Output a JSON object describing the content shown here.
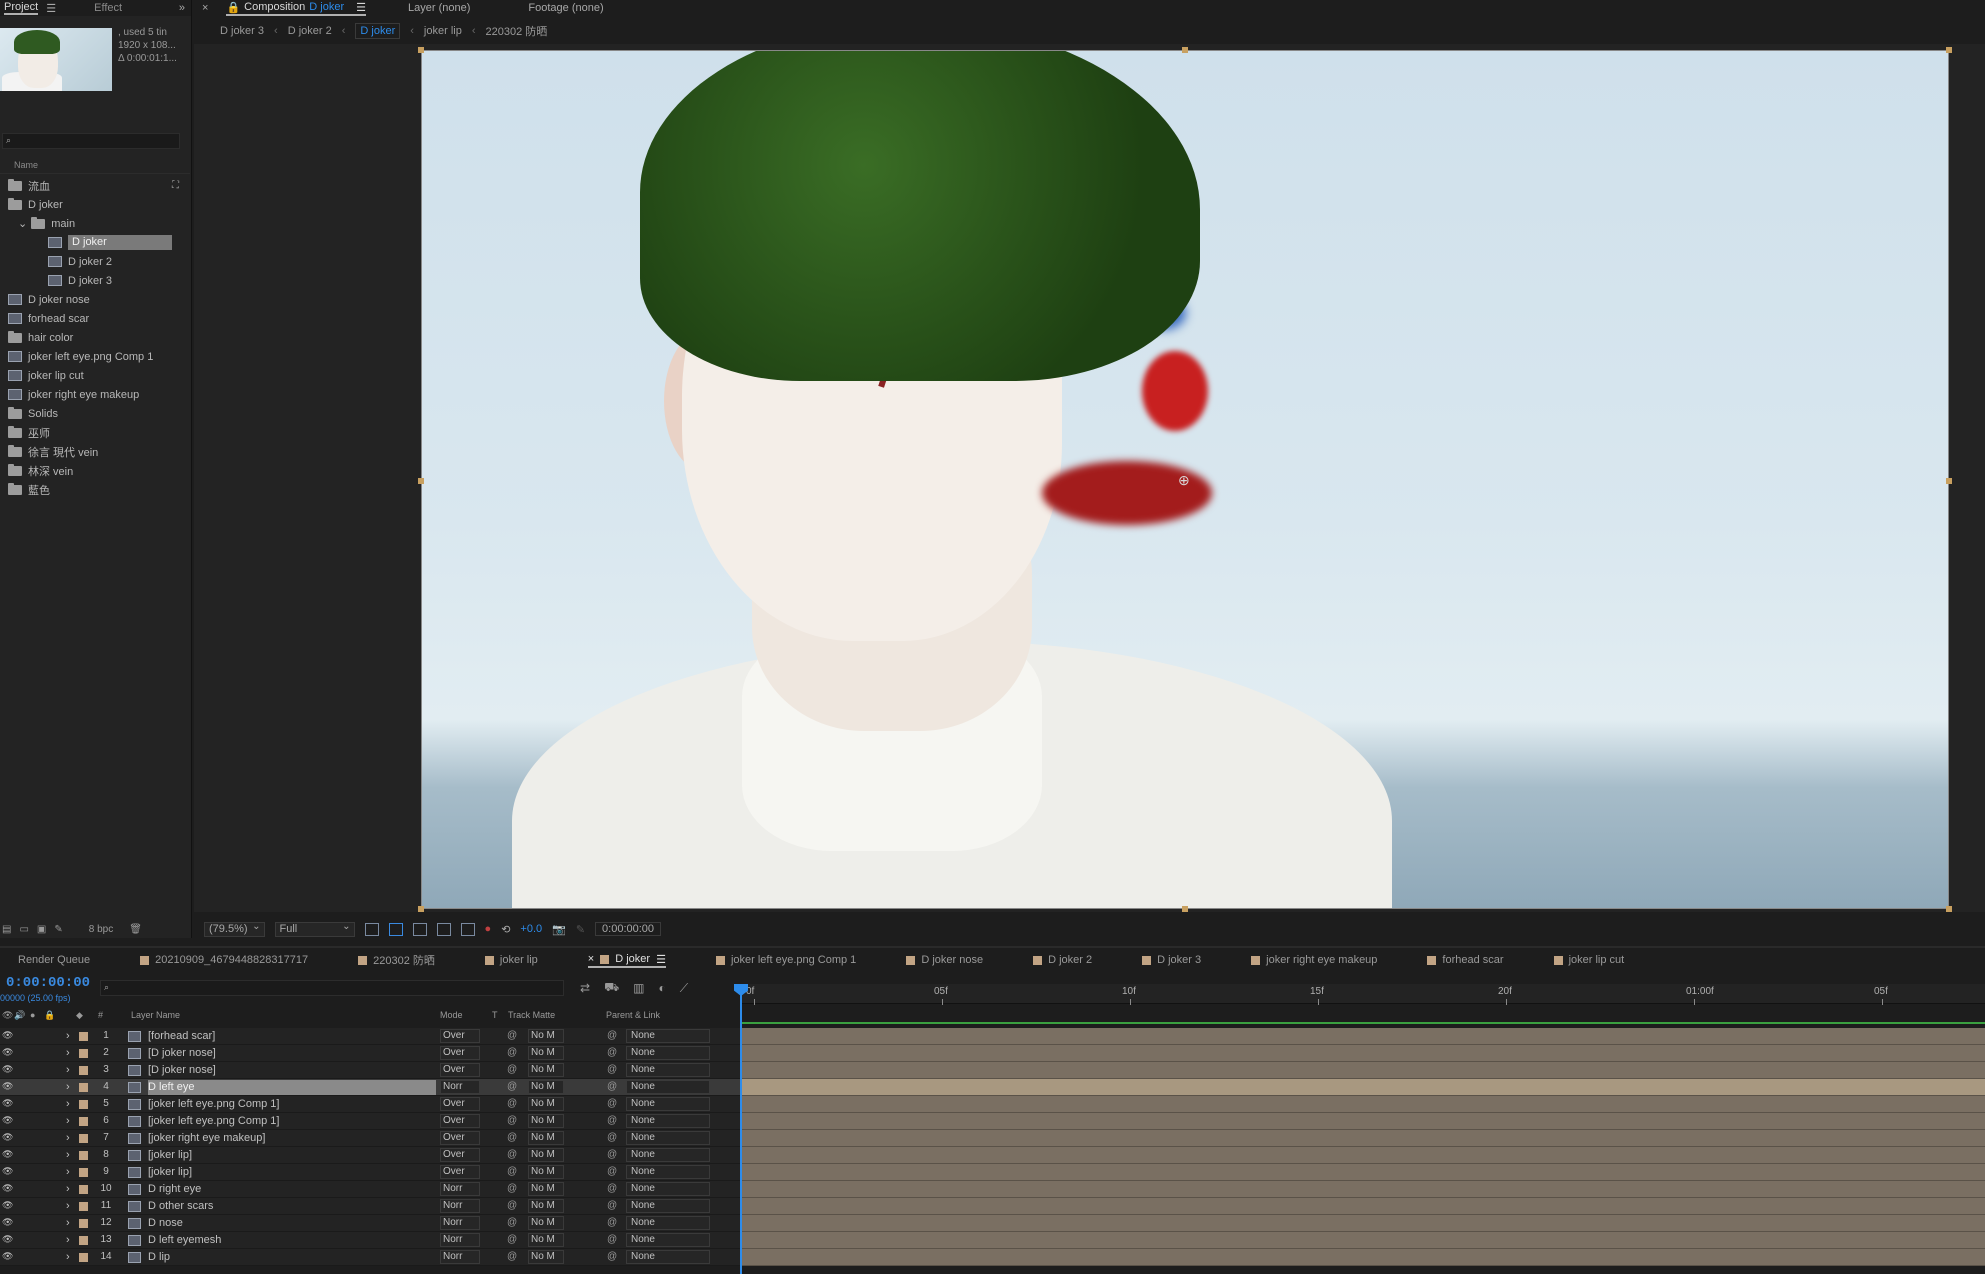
{
  "project": {
    "tabs": [
      "Project",
      "Effect"
    ],
    "info": ", used 5 tin",
    "resolution": "1920 x 108...",
    "duration": "Δ 0:00:01:1...",
    "name_header": "Name",
    "items": [
      {
        "label": "流血",
        "type": "folder",
        "indent": 0
      },
      {
        "label": "D joker",
        "type": "folder",
        "indent": 0
      },
      {
        "label": "main",
        "type": "folder",
        "indent": 1
      },
      {
        "label": "D joker",
        "type": "comp",
        "indent": 2,
        "selected": true
      },
      {
        "label": "D joker 2",
        "type": "comp",
        "indent": 2
      },
      {
        "label": "D joker 3",
        "type": "comp",
        "indent": 2
      },
      {
        "label": "D joker nose",
        "type": "comp",
        "indent": 0
      },
      {
        "label": "forhead scar",
        "type": "comp",
        "indent": 0
      },
      {
        "label": "hair color",
        "type": "folder",
        "indent": 0
      },
      {
        "label": "joker left eye.png Comp 1",
        "type": "comp",
        "indent": 0
      },
      {
        "label": "joker lip cut",
        "type": "comp",
        "indent": 0
      },
      {
        "label": "joker right eye makeup",
        "type": "comp",
        "indent": 0
      },
      {
        "label": "Solids",
        "type": "folder",
        "indent": 0
      },
      {
        "label": "巫师",
        "type": "folder",
        "indent": 0
      },
      {
        "label": "徐言 現代 vein",
        "type": "folder",
        "indent": 0
      },
      {
        "label": "林深 vein",
        "type": "folder",
        "indent": 0
      },
      {
        "label": "藍色",
        "type": "folder",
        "indent": 0
      }
    ],
    "bpc": "8 bpc"
  },
  "comp": {
    "tabs": [
      {
        "label": "Composition",
        "value": "D joker",
        "active": true
      },
      {
        "label": "Layer",
        "value": "(none)"
      },
      {
        "label": "Footage",
        "value": "(none)"
      }
    ],
    "crumbs": [
      "D joker 3",
      "D joker 2",
      "D joker",
      "joker lip",
      "220302 防晒"
    ],
    "active_crumb": "D joker",
    "zoom": "(79.5%)",
    "resolution": "Full",
    "exposure": "+0.0",
    "time": "0:00:00:00"
  },
  "timeline": {
    "tabs": [
      {
        "label": "Render Queue",
        "swatch": false
      },
      {
        "label": "20210909_4679448828317717",
        "swatch": true
      },
      {
        "label": "220302 防晒",
        "swatch": true
      },
      {
        "label": "joker lip",
        "swatch": true
      },
      {
        "label": "D joker",
        "swatch": true,
        "active": true
      },
      {
        "label": "joker left eye.png Comp 1",
        "swatch": true
      },
      {
        "label": "D joker nose",
        "swatch": true
      },
      {
        "label": "D joker 2",
        "swatch": true
      },
      {
        "label": "D joker 3",
        "swatch": true
      },
      {
        "label": "joker right eye makeup",
        "swatch": true
      },
      {
        "label": "forhead scar",
        "swatch": true
      },
      {
        "label": "joker lip cut",
        "swatch": true
      }
    ],
    "timecode": "0:00:00:00",
    "fps": "00000 (25.00 fps)",
    "headers": {
      "num": "#",
      "layer_name": "Layer Name",
      "mode": "Mode",
      "t": "T",
      "track_matte": "Track Matte",
      "parent": "Parent & Link"
    },
    "ruler": [
      "0f",
      "05f",
      "10f",
      "15f",
      "20f",
      "01:00f",
      "05f"
    ],
    "layers": [
      {
        "num": "1",
        "name": "[forhead scar]",
        "mode": "Over",
        "matte": "No M",
        "parent": "None"
      },
      {
        "num": "2",
        "name": "[D joker nose]",
        "mode": "Over",
        "matte": "No M",
        "parent": "None"
      },
      {
        "num": "3",
        "name": "[D joker nose]",
        "mode": "Over",
        "matte": "No M",
        "parent": "None"
      },
      {
        "num": "4",
        "name": "D left eye",
        "mode": "Norr",
        "matte": "No M",
        "parent": "None",
        "selected": true
      },
      {
        "num": "5",
        "name": "[joker left eye.png Comp 1]",
        "mode": "Over",
        "matte": "No M",
        "parent": "None"
      },
      {
        "num": "6",
        "name": "[joker left eye.png Comp 1]",
        "mode": "Over",
        "matte": "No M",
        "parent": "None"
      },
      {
        "num": "7",
        "name": "[joker right eye makeup]",
        "mode": "Over",
        "matte": "No M",
        "parent": "None"
      },
      {
        "num": "8",
        "name": "[joker lip]",
        "mode": "Over",
        "matte": "No M",
        "parent": "None"
      },
      {
        "num": "9",
        "name": "[joker lip]",
        "mode": "Over",
        "matte": "No M",
        "parent": "None"
      },
      {
        "num": "10",
        "name": "D right eye",
        "mode": "Norr",
        "matte": "No M",
        "parent": "None"
      },
      {
        "num": "11",
        "name": "D other scars",
        "mode": "Norr",
        "matte": "No M",
        "parent": "None"
      },
      {
        "num": "12",
        "name": "D nose",
        "mode": "Norr",
        "matte": "No M",
        "parent": "None"
      },
      {
        "num": "13",
        "name": "D left eyemesh",
        "mode": "Norr",
        "matte": "No M",
        "parent": "None"
      },
      {
        "num": "14",
        "name": "D lip",
        "mode": "Norr",
        "matte": "No M",
        "parent": "None"
      }
    ]
  },
  "colors": {
    "accent": "#2d8ceb",
    "label": "#c2a484",
    "panel": "#232323",
    "workarea": "#3aa040"
  }
}
